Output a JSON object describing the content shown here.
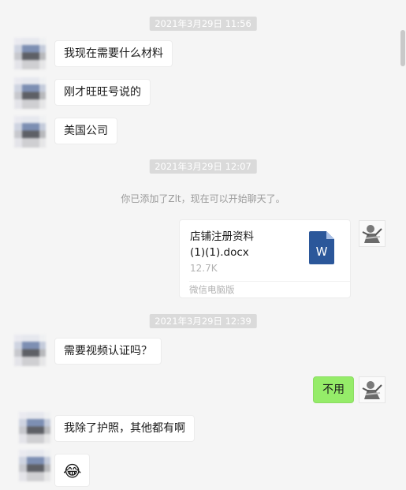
{
  "timestamps": [
    "2021年3月29日 11:56",
    "2021年3月29日 12:07",
    "2021年3月29日 12:39"
  ],
  "system_notice": "你已添加了Zlt，现在可以开始聊天了。",
  "messages": {
    "m1": "我现在需要什么材料",
    "m2": "刚才旺旺号说的",
    "m3": "美国公司",
    "m4": "需要视频认证吗？",
    "m5": "不用",
    "m6": "我除了护照，其他都有啊",
    "m7": "😂"
  },
  "file": {
    "name_line1": "店铺注册资料",
    "name_line2": "(1)(1).docx",
    "size": "12.7K",
    "source": "微信电脑版",
    "icon_letter": "W",
    "icon": "word-document-icon"
  },
  "colors": {
    "background": "#f5f5f5",
    "sent_bubble": "#95ec69",
    "received_bubble": "#ffffff",
    "word_blue": "#2b579a"
  }
}
